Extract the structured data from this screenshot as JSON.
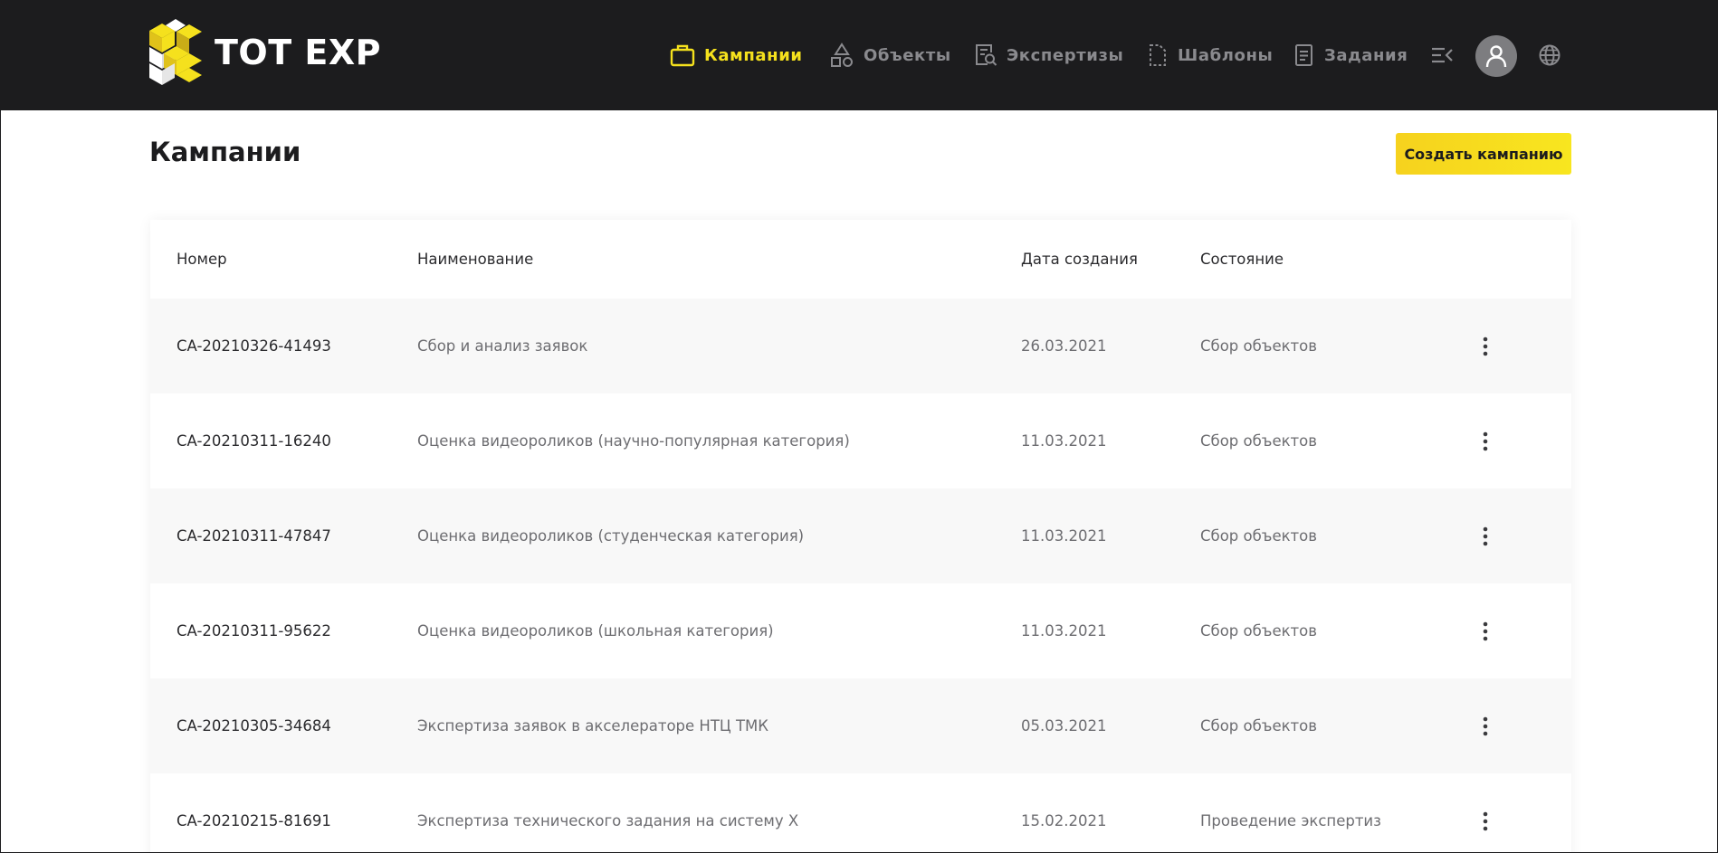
{
  "app": {
    "logo_text": "TOT EXP"
  },
  "nav": {
    "items": [
      {
        "label": "Кампании",
        "icon": "briefcase-icon",
        "active": true
      },
      {
        "label": "Объекты",
        "icon": "shapes-icon",
        "active": false
      },
      {
        "label": "Экспертизы",
        "icon": "document-search-icon",
        "active": false
      },
      {
        "label": "Шаблоны",
        "icon": "dashed-file-icon",
        "active": false
      },
      {
        "label": "Задания",
        "icon": "document-list-icon",
        "active": false
      }
    ],
    "collapse_icon": "collapse-menu-icon",
    "profile_icon": "user-icon",
    "language_icon": "globe-icon"
  },
  "page": {
    "title": "Кампании",
    "create_button": "Создать кампанию"
  },
  "table": {
    "columns": [
      "Номер",
      "Наименование",
      "Дата создания",
      "Состояние"
    ],
    "rows": [
      {
        "number": "CA-20210326-41493",
        "name": "Сбор и анализ заявок",
        "date": "26.03.2021",
        "state": "Сбор объектов"
      },
      {
        "number": "CA-20210311-16240",
        "name": "Оценка видеороликов (научно-популярная категория)",
        "date": "11.03.2021",
        "state": "Сбор объектов"
      },
      {
        "number": "CA-20210311-47847",
        "name": "Оценка видеороликов (студенческая категория)",
        "date": "11.03.2021",
        "state": "Сбор объектов"
      },
      {
        "number": "CA-20210311-95622",
        "name": "Оценка видеороликов (школьная категория)",
        "date": "11.03.2021",
        "state": "Сбор объектов"
      },
      {
        "number": "CA-20210305-34684",
        "name": "Экспертиза заявок в акселераторе НТЦ ТМК",
        "date": "05.03.2021",
        "state": "Сбор объектов"
      },
      {
        "number": "CA-20210215-81691",
        "name": "Экспертиза технического задания на систему X",
        "date": "15.02.2021",
        "state": "Проведение экспертиз"
      }
    ],
    "row_action_icon": "more-vertical-icon"
  },
  "colors": {
    "header_bg": "#1c1c1e",
    "accent": "#f5e11d",
    "nav_inactive": "#8a8a8e",
    "row_alt": "#f8f8f8"
  }
}
